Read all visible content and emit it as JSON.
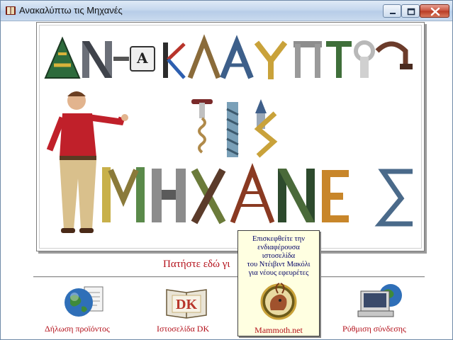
{
  "window": {
    "title": "Ανακαλύπτω τις Μηχανές",
    "icon": "book-icon",
    "controls": [
      "minimize-icon",
      "maximize-icon",
      "close-icon"
    ]
  },
  "poster": {
    "line1": "ΑΝΑΚΑΛΥΠΤΩ",
    "line2": "ΤΙΣ",
    "line3": "ΜΗΧΑΝΕΣ",
    "key_letter": "A"
  },
  "link_text": "Πατήστε εδώ γι",
  "bottom_items": [
    {
      "label": "Δήλωση προϊόντος",
      "icon": "globe-document-icon"
    },
    {
      "label": "Ιστοσελίδα DK",
      "icon": "dk-book-icon"
    },
    {
      "label": "Mammoth.net",
      "icon": "mammoth-icon"
    },
    {
      "label": "Ρύθμιση σύνδεσης",
      "icon": "globe-computer-icon"
    }
  ],
  "tooltip": {
    "lines": [
      "Επισκεφθείτε την",
      "ενδιαφέρουσα",
      "ιστοσελίδα",
      "του Ντέιβιντ Μακόλι",
      "για νέους εφευρέτες"
    ]
  },
  "colors": {
    "link_red": "#b3101a",
    "tooltip_bg": "#ffffe1",
    "titlebar": "#c6d8ee"
  }
}
